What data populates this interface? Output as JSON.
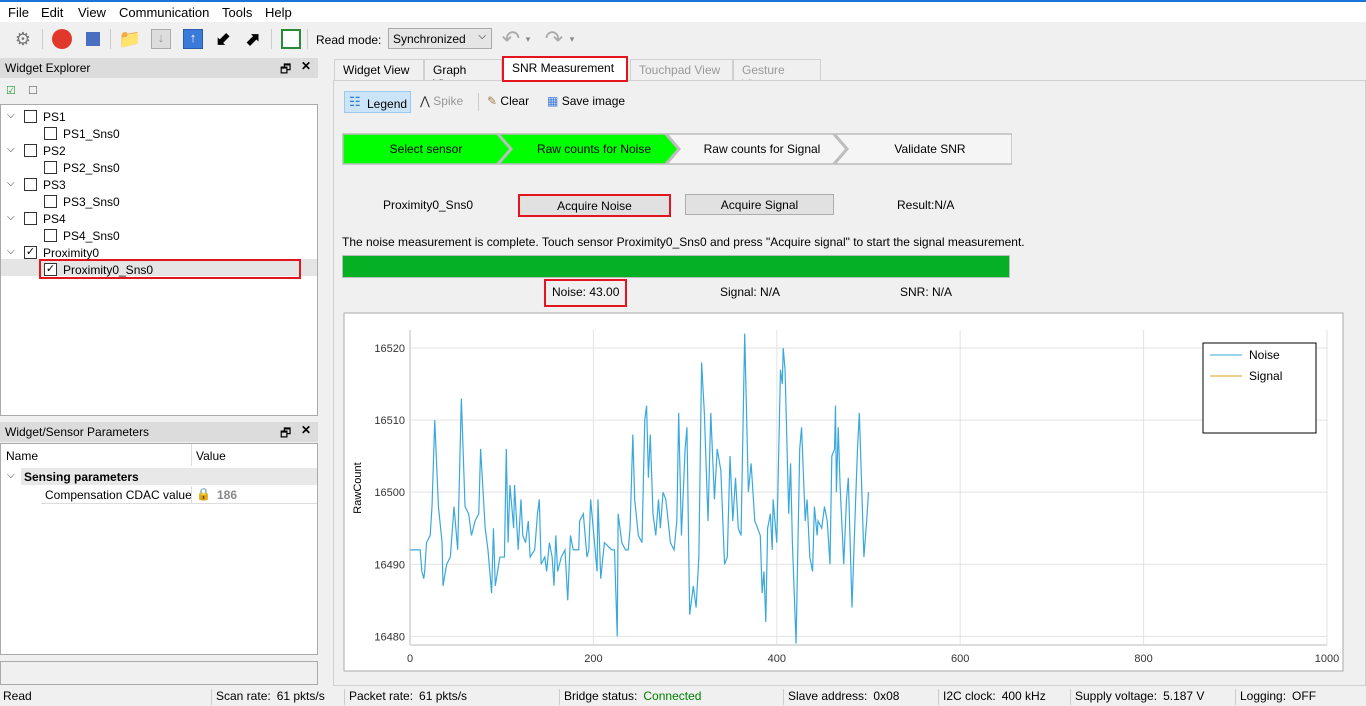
{
  "menu": [
    "File",
    "Edit",
    "View",
    "Communication",
    "Tools",
    "Help"
  ],
  "toolbar": {
    "read_mode_label": "Read mode:",
    "read_mode_value": "Synchronized"
  },
  "widget_explorer": {
    "title": "Widget Explorer",
    "items": [
      {
        "label": "PS1",
        "checked": false,
        "children": [
          {
            "label": "PS1_Sns0",
            "checked": false
          }
        ]
      },
      {
        "label": "PS2",
        "checked": false,
        "children": [
          {
            "label": "PS2_Sns0",
            "checked": false
          }
        ]
      },
      {
        "label": "PS3",
        "checked": false,
        "children": [
          {
            "label": "PS3_Sns0",
            "checked": false
          }
        ]
      },
      {
        "label": "PS4",
        "checked": false,
        "children": [
          {
            "label": "PS4_Sns0",
            "checked": false
          }
        ]
      },
      {
        "label": "Proximity0",
        "checked": true,
        "children": [
          {
            "label": "Proximity0_Sns0",
            "checked": true
          }
        ]
      }
    ]
  },
  "params": {
    "title": "Widget/Sensor Parameters",
    "col_name": "Name",
    "col_value": "Value",
    "group": "Sensing parameters",
    "row_name": "Compensation CDAC value",
    "row_value": "186"
  },
  "tabs": [
    {
      "label": "Widget View",
      "enabled": true
    },
    {
      "label": "Graph View",
      "enabled": true
    },
    {
      "label": "SNR Measurement",
      "enabled": true,
      "active": true
    },
    {
      "label": "Touchpad View",
      "enabled": false
    },
    {
      "label": "Gesture View",
      "enabled": false
    }
  ],
  "snr_toolbar": {
    "legend": "Legend",
    "spike": "Spike",
    "clear": "Clear",
    "save_image": "Save image"
  },
  "steps": [
    {
      "label": "Select sensor",
      "done": true
    },
    {
      "label": "Raw counts for Noise",
      "done": true
    },
    {
      "label": "Raw counts for Signal",
      "done": false
    },
    {
      "label": "Validate SNR",
      "done": false
    }
  ],
  "sensor_name": "Proximity0_Sns0",
  "acquire_noise": "Acquire Noise",
  "acquire_signal": "Acquire Signal",
  "result": "Result:N/A",
  "message": "The noise measurement is complete. Touch sensor Proximity0_Sns0 and press \"Acquire signal\" to start the signal measurement.",
  "progress_percent": 100,
  "noise": "Noise:  43.00",
  "signal": "Signal:  N/A",
  "snr": "SNR:  N/A",
  "colors": {
    "step_done": "#00ff00",
    "progress": "#06b025",
    "noise_line": "#3aa8dc",
    "signal_line": "#e0a020",
    "highlight": "#e3151f",
    "connected": "#008000"
  },
  "chart_data": {
    "type": "line",
    "ylabel": "RawCount",
    "xlim": [
      0,
      1000
    ],
    "ylim": [
      16478.8,
      16522.5
    ],
    "xticks": [
      0,
      200,
      400,
      600,
      800,
      1000
    ],
    "yticks": [
      16480,
      16490,
      16500,
      16510,
      16520
    ],
    "grid": true,
    "legend_position": "top-right",
    "series": [
      {
        "name": "Noise",
        "color": "#3aa8dc",
        "points": [
          [
            0,
            16492
          ],
          [
            11,
            16492
          ],
          [
            13,
            16489
          ],
          [
            15,
            16488
          ],
          [
            16,
            16489
          ],
          [
            18,
            16493
          ],
          [
            22,
            16494
          ],
          [
            24,
            16498
          ],
          [
            27,
            16510
          ],
          [
            31,
            16498
          ],
          [
            35,
            16493
          ],
          [
            36,
            16487
          ],
          [
            40,
            16490
          ],
          [
            44,
            16491
          ],
          [
            48,
            16498
          ],
          [
            52,
            16492
          ],
          [
            56,
            16513
          ],
          [
            60,
            16498
          ],
          [
            64,
            16497
          ],
          [
            67,
            16494
          ],
          [
            71,
            16496
          ],
          [
            75,
            16497
          ],
          [
            77,
            16506
          ],
          [
            82,
            16495
          ],
          [
            85,
            16492
          ],
          [
            89,
            16486
          ],
          [
            91,
            16495
          ],
          [
            93,
            16487
          ],
          [
            98,
            16491
          ],
          [
            103,
            16491
          ],
          [
            105,
            16506
          ],
          [
            107,
            16493
          ],
          [
            109,
            16501
          ],
          [
            113,
            16495
          ],
          [
            114,
            16501
          ],
          [
            118,
            16492
          ],
          [
            121,
            16499
          ],
          [
            123,
            16494
          ],
          [
            126,
            16493
          ],
          [
            129,
            16496
          ],
          [
            131,
            16491
          ],
          [
            136,
            16492
          ],
          [
            139,
            16497
          ],
          [
            141,
            16499
          ],
          [
            143,
            16490
          ],
          [
            147,
            16491
          ],
          [
            149,
            16489
          ],
          [
            152,
            16493
          ],
          [
            155,
            16491
          ],
          [
            157,
            16487
          ],
          [
            159,
            16494
          ],
          [
            161,
            16489
          ],
          [
            165,
            16491
          ],
          [
            169,
            16492
          ],
          [
            172,
            16485
          ],
          [
            175,
            16494
          ],
          [
            178,
            16492
          ],
          [
            184,
            16492
          ],
          [
            185,
            16496
          ],
          [
            189,
            16497
          ],
          [
            193,
            16491
          ],
          [
            195,
            16492
          ],
          [
            197,
            16499
          ],
          [
            204,
            16489
          ],
          [
            205,
            16499
          ],
          [
            208,
            16488
          ],
          [
            212,
            16493
          ],
          [
            220,
            16492
          ],
          [
            223,
            16492
          ],
          [
            226,
            16480
          ],
          [
            227,
            16497
          ],
          [
            231,
            16493
          ],
          [
            235,
            16492
          ],
          [
            238,
            16492
          ],
          [
            240,
            16495
          ],
          [
            243,
            16508
          ],
          [
            245,
            16499
          ],
          [
            249,
            16494
          ],
          [
            253,
            16493
          ],
          [
            256,
            16510
          ],
          [
            258,
            16512
          ],
          [
            260,
            16502
          ],
          [
            262,
            16508
          ],
          [
            265,
            16497
          ],
          [
            268,
            16494
          ],
          [
            271,
            16499
          ],
          [
            273,
            16495
          ],
          [
            276,
            16500
          ],
          [
            279,
            16499
          ],
          [
            284,
            16493
          ],
          [
            288,
            16492
          ],
          [
            291,
            16496
          ],
          [
            293,
            16511
          ],
          [
            296,
            16494
          ],
          [
            300,
            16506
          ],
          [
            302,
            16509
          ],
          [
            305,
            16483
          ],
          [
            309,
            16487
          ],
          [
            312,
            16484
          ],
          [
            315,
            16491
          ],
          [
            318,
            16518
          ],
          [
            321,
            16511
          ],
          [
            325,
            16496
          ],
          [
            328,
            16511
          ],
          [
            332,
            16499
          ],
          [
            335,
            16506
          ],
          [
            339,
            16503
          ],
          [
            343,
            16490
          ],
          [
            346,
            16491
          ],
          [
            349,
            16505
          ],
          [
            352,
            16496
          ],
          [
            355,
            16502
          ],
          [
            358,
            16495
          ],
          [
            361,
            16494
          ],
          [
            365,
            16522
          ],
          [
            369,
            16500
          ],
          [
            372,
            16504
          ],
          [
            376,
            16496
          ],
          [
            382,
            16494
          ],
          [
            384,
            16486
          ],
          [
            386,
            16489
          ],
          [
            388,
            16482
          ],
          [
            390,
            16495
          ],
          [
            393,
            16497
          ],
          [
            395,
            16492
          ],
          [
            396,
            16499
          ],
          [
            400,
            16493
          ],
          [
            404,
            16517
          ],
          [
            406,
            16515
          ],
          [
            407,
            16520
          ],
          [
            409,
            16517
          ],
          [
            413,
            16497
          ],
          [
            415,
            16504
          ],
          [
            417,
            16493
          ],
          [
            421,
            16479
          ],
          [
            425,
            16506
          ],
          [
            427,
            16509
          ],
          [
            431,
            16496
          ],
          [
            433,
            16499
          ],
          [
            436,
            16491
          ],
          [
            439,
            16489
          ],
          [
            441,
            16498
          ],
          [
            444,
            16494
          ],
          [
            445,
            16496
          ],
          [
            449,
            16495
          ],
          [
            452,
            16498
          ],
          [
            455,
            16496
          ],
          [
            458,
            16490
          ],
          [
            460,
            16505
          ],
          [
            463,
            16506
          ],
          [
            464,
            16512
          ],
          [
            465,
            16500
          ],
          [
            467,
            16509
          ],
          [
            469,
            16501
          ],
          [
            473,
            16490
          ],
          [
            476,
            16499
          ],
          [
            478,
            16502
          ],
          [
            482,
            16484
          ],
          [
            486,
            16499
          ],
          [
            488,
            16506
          ],
          [
            490,
            16511
          ],
          [
            495,
            16491
          ],
          [
            498,
            16496
          ],
          [
            500,
            16500
          ]
        ]
      },
      {
        "name": "Signal",
        "color": "#e0a020",
        "points": []
      }
    ]
  },
  "status": {
    "mode": "Read",
    "scan_rate_label": "Scan rate:",
    "scan_rate": "61 pkts/s",
    "packet_rate_label": "Packet rate:",
    "packet_rate": "61 pkts/s",
    "bridge_label": "Bridge status:",
    "bridge": "Connected",
    "slave_label": "Slave address:",
    "slave": "0x08",
    "i2c_label": "I2C clock:",
    "i2c": "400 kHz",
    "voltage_label": "Supply voltage:",
    "voltage": "5.187 V",
    "logging_label": "Logging:",
    "logging": "OFF"
  }
}
